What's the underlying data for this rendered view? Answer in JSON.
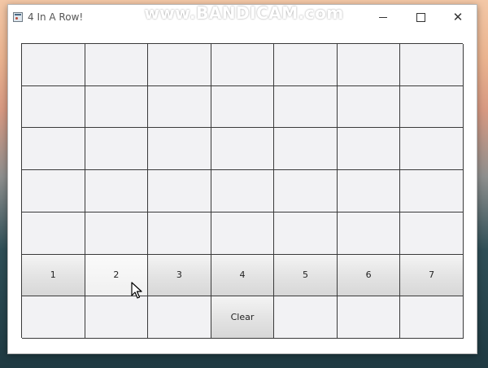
{
  "watermark": "www.BANDICAM.com",
  "window": {
    "title": "4 In A Row!",
    "controls": {
      "minimize": "minimize",
      "maximize": "maximize",
      "close": "close"
    }
  },
  "board": {
    "rows": 5,
    "columns": 7
  },
  "column_buttons": [
    {
      "label": "1"
    },
    {
      "label": "2"
    },
    {
      "label": "3"
    },
    {
      "label": "4"
    },
    {
      "label": "5"
    },
    {
      "label": "6"
    },
    {
      "label": "7"
    }
  ],
  "clear_button": {
    "label": "Clear"
  },
  "colors": {
    "cell": "#f2f2f4",
    "grid_line": "#3a3a3a",
    "button": "#dcdcdc"
  }
}
